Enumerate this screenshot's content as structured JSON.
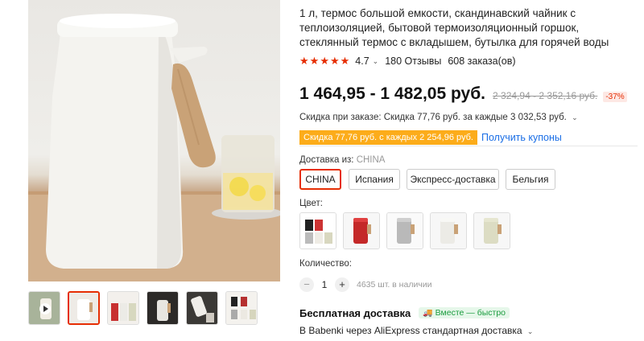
{
  "product": {
    "title": "1 л, термос большой емкости, скандинавский чайник с теплоизоляцией, бытовой термоизоляционный горшок, стеклянный термос с вкладышем, бутылка для горячей воды",
    "rating": "4.7",
    "reviews": "180 Отзывы",
    "orders": "608 заказа(ов)",
    "price": "1 464,95 - 1 482,05 руб.",
    "old_price": "2 324,94 - 2 352,16 руб.",
    "discount": "-37%"
  },
  "coupons": {
    "order_discount": "Скидка при заказе: Скидка 77,76 руб. за каждые 3 032,53 руб.",
    "badge": "Скидка 77,76 руб. с каждых 2 254,96 руб.",
    "get_link": "Получить купоны"
  },
  "shipping_from": {
    "label": "Доставка из:",
    "value": "CHINA",
    "options": [
      "CHINA",
      "Испания",
      "Экспресс-доставка",
      "Бельгия"
    ]
  },
  "color": {
    "label": "Цвет:",
    "swatches": [
      "set",
      "red",
      "gray",
      "white",
      "beige"
    ]
  },
  "quantity": {
    "label": "Количество:",
    "value": "1",
    "minus": "−",
    "plus": "+",
    "stock": "4635 шт. в наличии"
  },
  "delivery": {
    "free": "Бесплатная доставка",
    "together_badge": "Вместе — быстро",
    "method": "В Babenki через AliExpress стандартная доставка"
  },
  "icons": {
    "star": "star-icon",
    "chevron": "chevron-down-icon",
    "truck": "truck-icon"
  },
  "colors": {
    "accent": "#e62e04",
    "coupon": "#fcac1a",
    "link": "#1a6ee6",
    "green": "#1a9c3e"
  }
}
